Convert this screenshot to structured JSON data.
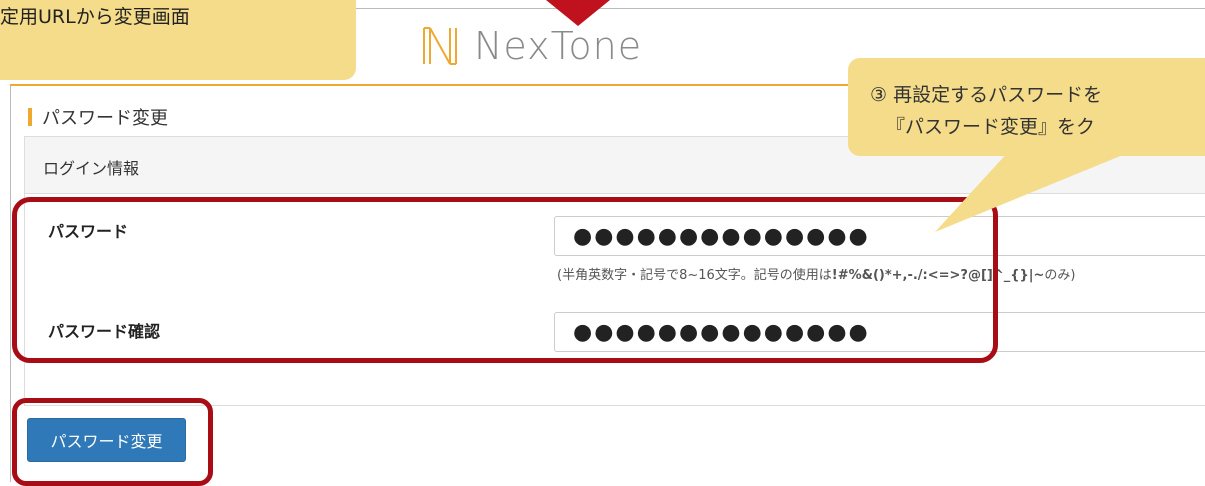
{
  "annotations": {
    "left_callout": "定用URLから変更画面",
    "right_callout_line1": "③ 再設定するパスワードを",
    "right_callout_line2": "『パスワード変更』をク"
  },
  "header": {
    "logo_text": "NexTone"
  },
  "page": {
    "section_title": "パスワード変更"
  },
  "panel": {
    "heading": "ログイン情報"
  },
  "form": {
    "password_label": "パスワード",
    "password_value": "●●●●●●●●●●●●●●",
    "password_help_prefix": "(半角英数字・記号で8~16文字。記号の使用は",
    "password_help_symbols": "!#%&()*+,-./:<=>?@[]^_{}|~",
    "password_help_suffix": "のみ)",
    "confirm_label": "パスワード確認",
    "confirm_value": "●●●●●●●●●●●●●●",
    "submit_label": "パスワード変更"
  },
  "colors": {
    "accent": "#f0a830",
    "button": "#2f79b9",
    "highlight": "#a80d16",
    "callout": "#f4dc8a"
  }
}
